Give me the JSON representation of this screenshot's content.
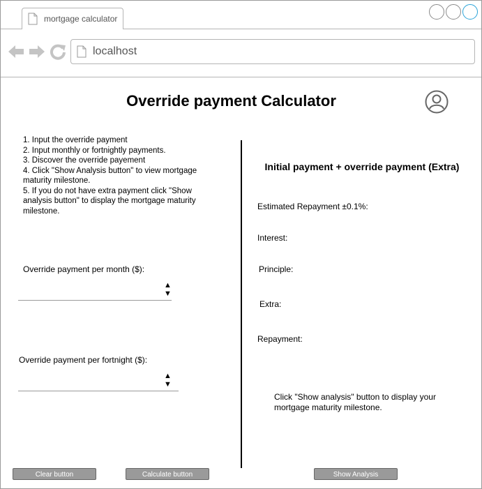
{
  "browser": {
    "tab_title": "mortgage calculator",
    "address": "localhost"
  },
  "page": {
    "title": "Override payment Calculator"
  },
  "instructions": [
    "1. Input the override payment",
    "2. Input monthly or fortnightly payments.",
    "3. Discover the override payement",
    "4. Click \"Show Analysis button\" to view mortgage maturity milestone.",
    "5. If you do not have extra payment click \"Show analysis button\" to display the mortgage maturity milestone."
  ],
  "form": {
    "monthly_label": "Override payment per month ($):",
    "fortnightly_label": "Override payment per fortnight ($):",
    "spinner_up": "▲",
    "spinner_down": "▼"
  },
  "results": {
    "title": "Initial payment + override payment (Extra)",
    "estimated_label": "Estimated Repayment ±0.1%:",
    "interest_label": "Interest:",
    "principle_label": "Principle:",
    "extra_label": "Extra:",
    "repayment_label": "Repayment:",
    "hint": "Click \"Show analysis\" button to display your mortgage maturity milestone."
  },
  "buttons": {
    "clear": "Clear button",
    "calculate": "Calculate button",
    "show_analysis": "Show Analysis"
  },
  "icons": {
    "back": "back-arrow-icon",
    "forward": "forward-arrow-icon",
    "reload": "reload-icon",
    "page": "page-icon",
    "user": "user-icon"
  },
  "colors": {
    "window_border": "#9a9a9a",
    "button_bg": "#9a9a9a",
    "active_window_button": "#29a3d8"
  }
}
